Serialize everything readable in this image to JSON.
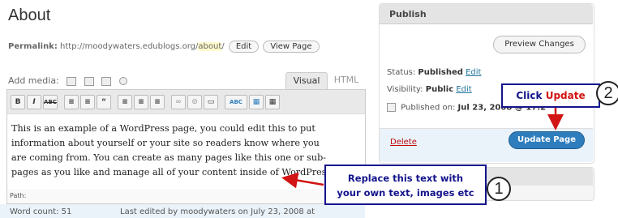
{
  "editor": {
    "title": "About",
    "permalink_label": "Permalink:",
    "permalink_base": "http://moodywaters.edublogs.org/",
    "permalink_slug": "about",
    "permalink_trailing": "/",
    "edit_button": "Edit",
    "view_page_button": "View Page",
    "add_media_label": "Add media:",
    "tab_visual": "Visual",
    "tab_html": "HTML",
    "toolbar_buttons": [
      "B",
      "I",
      "ABC",
      "≡",
      "≡",
      "“",
      "≡",
      "≡",
      "≡",
      "∞",
      "⊘",
      "▭",
      "ABC",
      "▦",
      "▦"
    ],
    "content": "This is an example of a WordPress page, you could edit this to put information about yourself or your site so readers know where you are coming from. You can create as many pages like this one or sub-pages as you like and manage all of your content inside of WordPress.",
    "path_label": "Path:",
    "word_count": "Word count: 51",
    "last_edited": "Last edited by moodywaters on July 23, 2008 at"
  },
  "publish": {
    "title": "Publish",
    "preview_button": "Preview Changes",
    "status_label": "Status:",
    "status_value": "Published",
    "visibility_label": "Visibility:",
    "visibility_value": "Public",
    "published_label": "Published on:",
    "published_value": "Jul 23, 2008 @ 17:2",
    "edit_link": "Edit",
    "delete_link": "Delete",
    "update_button": "Update Page"
  },
  "annotations": {
    "callout_update_prefix": "Click",
    "callout_update_action": "Update",
    "callout_update_number": "2",
    "callout_replace_line1": "Replace this text with",
    "callout_replace_line2": "your own text, images etc",
    "callout_replace_number": "1",
    "accent_navy": "#14148c",
    "accent_red": "#d21414"
  }
}
